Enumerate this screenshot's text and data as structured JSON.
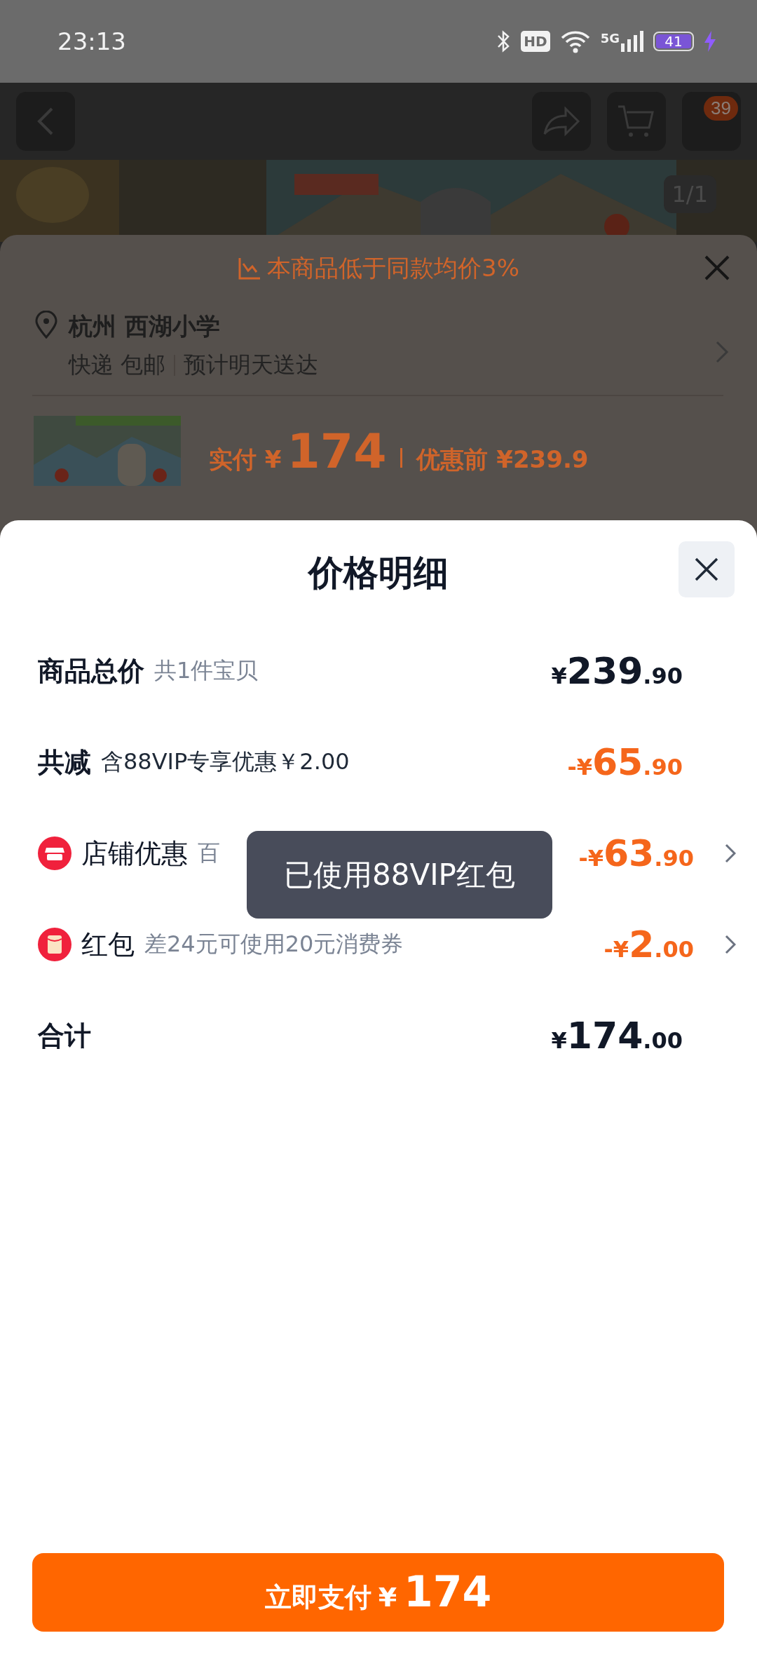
{
  "status_bar": {
    "time": "23:13",
    "hd": "HD",
    "network": "5G",
    "battery": "41"
  },
  "background_page": {
    "cart_badge": "39",
    "image_counter": "1/1",
    "banner": "本商品低于同款均价3%",
    "address": "杭州 西湖小学",
    "delivery": "快递 包邮",
    "eta": "预计明天送达",
    "price_label": "实付",
    "price_currency": "¥",
    "price": "174",
    "original_price": "优惠前 ¥239.9"
  },
  "sheet": {
    "title": "价格明细",
    "rows": [
      {
        "kind": "summary",
        "label": "商品总价",
        "note": "共1件宝贝",
        "note_dark": false,
        "discount": false,
        "has_detail": false,
        "amount": {
          "currency": "¥",
          "integer": "239",
          "decimal": ".90"
        }
      },
      {
        "kind": "summary",
        "label": "共减",
        "note": "含88VIP专享优惠￥2.00",
        "note_dark": true,
        "discount": true,
        "has_detail": false,
        "amount": {
          "sign": "-",
          "currency": "¥",
          "integer": "65",
          "decimal": ".90"
        }
      },
      {
        "kind": "store",
        "label": "店铺优惠",
        "note": "百",
        "note_dark": false,
        "discount": true,
        "has_detail": true,
        "amount": {
          "sign": "-",
          "currency": "¥",
          "integer": "63",
          "decimal": ".90"
        }
      },
      {
        "kind": "envelope",
        "label": "红包",
        "note": "差24元可使用20元消费券",
        "note_dark": false,
        "discount": true,
        "has_detail": true,
        "amount": {
          "sign": "-",
          "currency": "¥",
          "integer": "2",
          "decimal": ".00"
        }
      },
      {
        "kind": "total",
        "label": "合计",
        "discount": false,
        "has_detail": false,
        "amount": {
          "currency": "¥",
          "integer": "174",
          "decimal": ".00"
        }
      }
    ],
    "pay_button": {
      "label": "立即支付",
      "currency": "¥",
      "amount": "174"
    }
  },
  "toast": "已使用88VIP红包"
}
